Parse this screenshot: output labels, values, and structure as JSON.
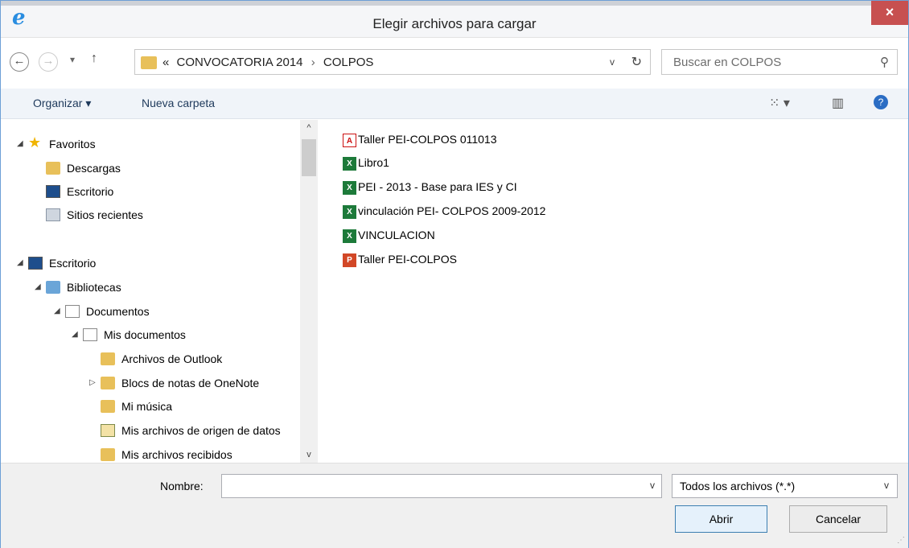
{
  "window": {
    "title": "Elegir archivos para cargar",
    "close": "×",
    "app_icon": "e"
  },
  "nav": {
    "back": "←",
    "forward": "→",
    "recent": "▾",
    "up": "↑",
    "path_prefix": "«",
    "path": [
      "CONVOCATORIA 2014",
      "COLPOS"
    ],
    "path_sep": "›",
    "dropdown": "v",
    "refresh": "↻",
    "search_placeholder": "Buscar en COLPOS",
    "search_icon": "⚲"
  },
  "toolbar": {
    "organize": "Organizar ▾",
    "new_folder": "Nueva carpeta",
    "view_icon": "⁙ ▾",
    "pane_icon": "▥",
    "help_icon": "?"
  },
  "sidebar": {
    "items": [
      {
        "label": "Favoritos",
        "icon": "star-icon",
        "level": 0,
        "arrow": "◢"
      },
      {
        "label": "Descargas",
        "icon": "download-folder-icon",
        "level": 1,
        "arrow": ""
      },
      {
        "label": "Escritorio",
        "icon": "desktop-icon",
        "level": 1,
        "arrow": ""
      },
      {
        "label": "Sitios recientes",
        "icon": "recent-places-icon",
        "level": 1,
        "arrow": ""
      },
      {
        "label": "Escritorio",
        "icon": "desktop-icon",
        "level": 0,
        "arrow": "◢"
      },
      {
        "label": "Bibliotecas",
        "icon": "libraries-icon",
        "level": 1,
        "arrow": "◢"
      },
      {
        "label": "Documentos",
        "icon": "documents-icon",
        "level": 2,
        "arrow": "◢"
      },
      {
        "label": "Mis documentos",
        "icon": "documents-icon",
        "level": 3,
        "arrow": "◢"
      },
      {
        "label": "Archivos de Outlook",
        "icon": "folder-icon",
        "level": 4,
        "arrow": ""
      },
      {
        "label": "Blocs de notas de OneNote",
        "icon": "folder-icon",
        "level": 4,
        "arrow": "▷"
      },
      {
        "label": "Mi música",
        "icon": "music-folder-icon",
        "level": 4,
        "arrow": ""
      },
      {
        "label": "Mis archivos de origen de datos",
        "icon": "data-sources-icon",
        "level": 4,
        "arrow": ""
      },
      {
        "label": "Mis archivos recibidos",
        "icon": "folder-icon",
        "level": 4,
        "arrow": ""
      }
    ],
    "scroll_up": "^",
    "scroll_down": "v"
  },
  "files": [
    {
      "name": "Taller PEI-COLPOS 011013",
      "type": "pdf",
      "glyph": "A"
    },
    {
      "name": "Libro1",
      "type": "xls",
      "glyph": "X"
    },
    {
      "name": "PEI - 2013 - Base para IES y CI",
      "type": "xls",
      "glyph": "X"
    },
    {
      "name": "vinculación PEI- COLPOS 2009-2012",
      "type": "xls",
      "glyph": "X"
    },
    {
      "name": "VINCULACION",
      "type": "xls",
      "glyph": "X"
    },
    {
      "name": "Taller PEI-COLPOS",
      "type": "ppt",
      "glyph": "P"
    }
  ],
  "bottom": {
    "name_label": "Nombre:",
    "name_value": "",
    "name_dropdown": "v",
    "filter": "Todos los archivos (*.*)",
    "filter_dropdown": "v",
    "open": "Abrir",
    "cancel": "Cancelar",
    "grip": "⋰"
  }
}
